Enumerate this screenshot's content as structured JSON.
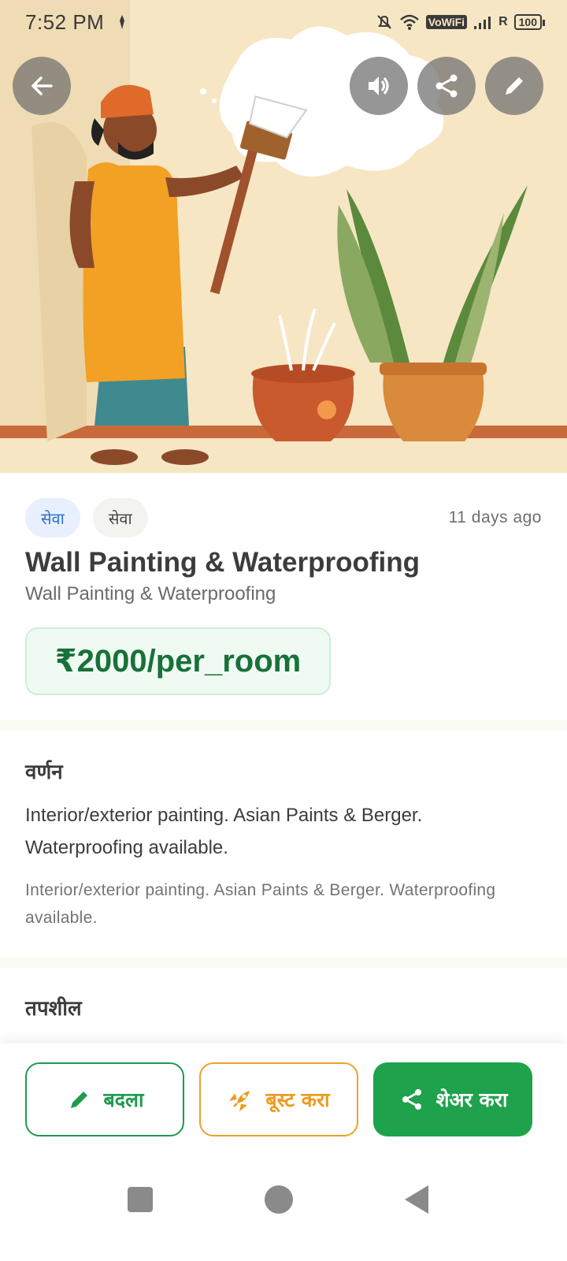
{
  "status_bar": {
    "time": "7:52 PM",
    "network_label": "VoWiFi",
    "roaming": "R",
    "battery": "100"
  },
  "hero": {
    "image_icon": "painter-illustration",
    "back_icon": "arrow-left-icon",
    "sound_icon": "volume-icon",
    "share_icon": "share-icon",
    "edit_icon": "pencil-icon"
  },
  "listing": {
    "tags": [
      "सेवा",
      "सेवा"
    ],
    "posted": "11 days ago",
    "title": "Wall Painting & Waterproofing",
    "subtitle": "Wall Painting & Waterproofing",
    "price": "₹2000/per_room"
  },
  "description": {
    "heading": "वर्णन",
    "text": "Interior/exterior painting. Asian Paints & Berger. Waterproofing available.",
    "text_secondary": "Interior/exterior painting. Asian Paints & Berger. Waterproofing available."
  },
  "details": {
    "heading": "तपशील"
  },
  "actions": {
    "edit_label": "बदला",
    "boost_label": "बूस्ट करा",
    "share_label": "शेअर करा"
  },
  "colors": {
    "accent_green": "#1ea24c",
    "accent_orange": "#ee9a1c",
    "price_green": "#19703a",
    "chip_blue": "#2a6fd6"
  }
}
